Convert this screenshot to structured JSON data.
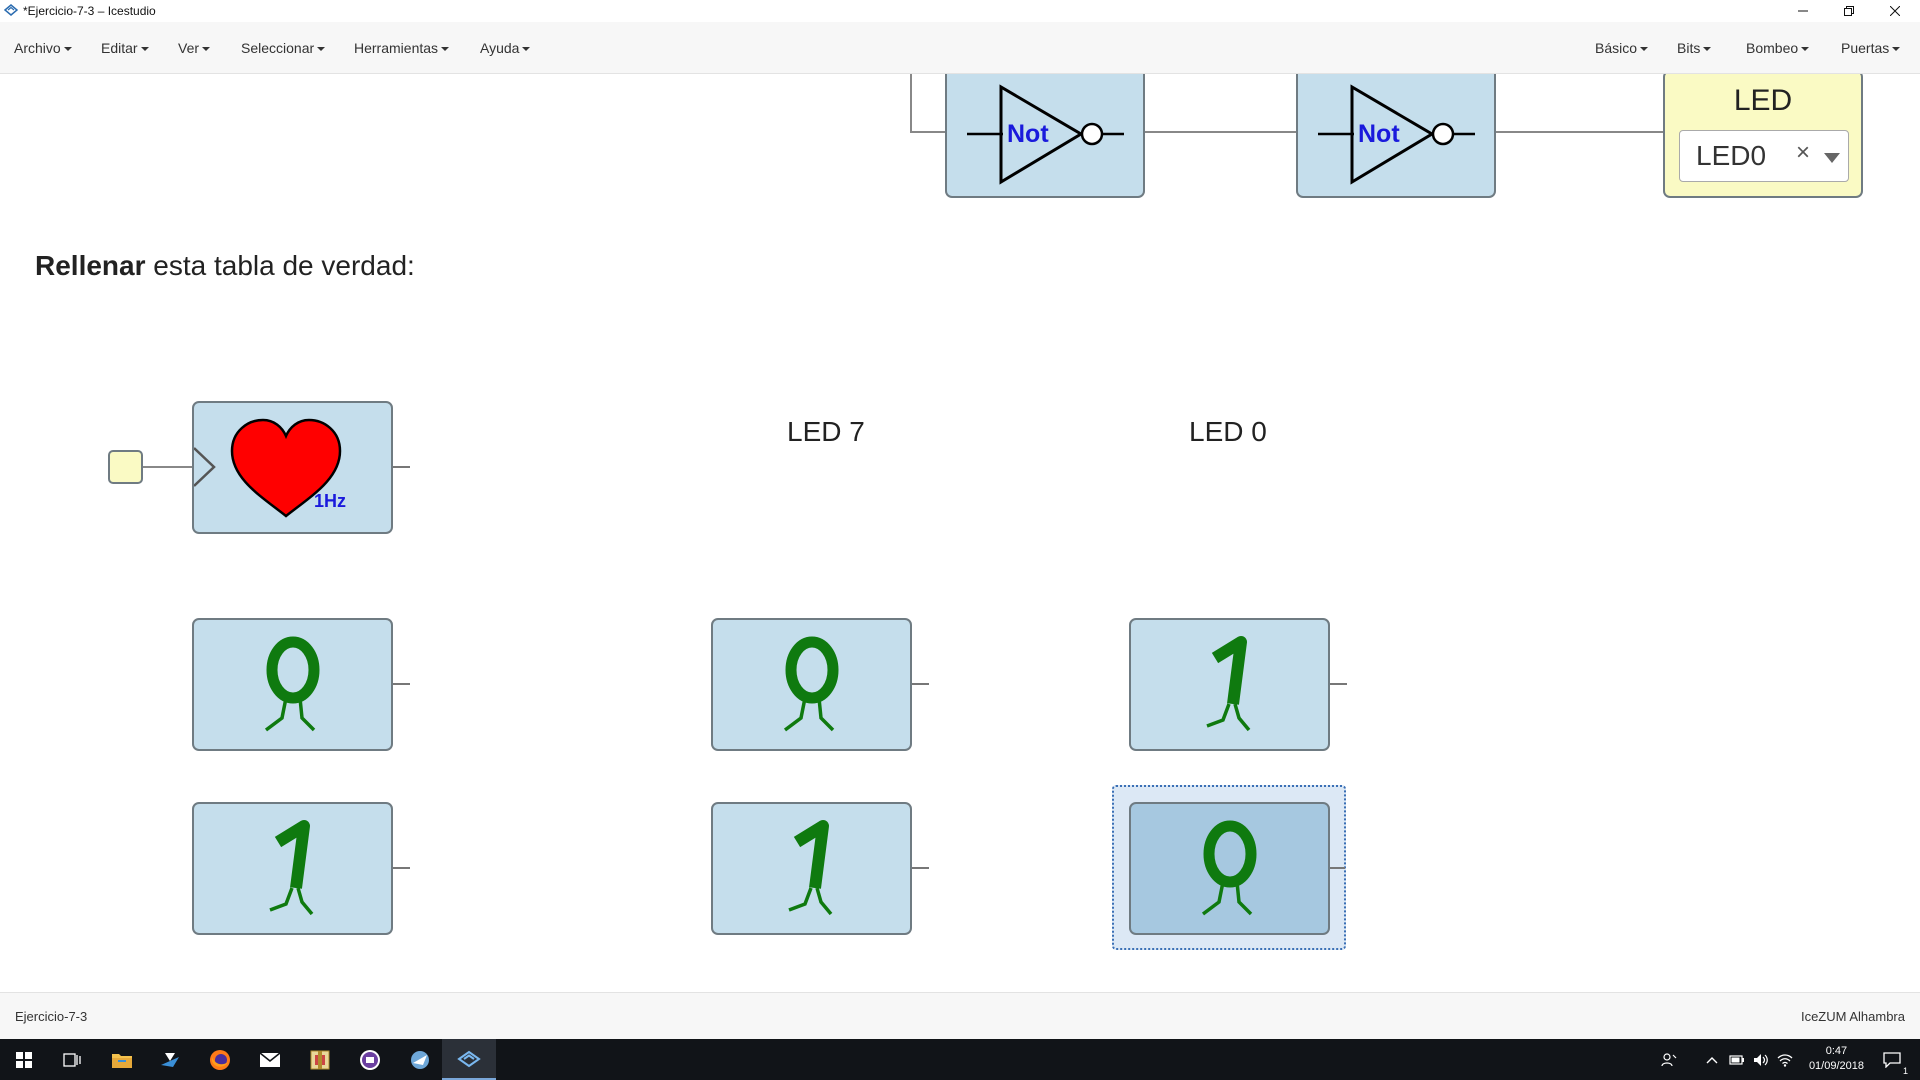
{
  "window": {
    "title": "*Ejercicio-7-3 – Icestudio",
    "minimize": "—",
    "restore": "❐",
    "close": "✕"
  },
  "menu_left": [
    "Archivo",
    "Editar",
    "Ver",
    "Seleccionar",
    "Herramientas",
    "Ayuda"
  ],
  "menu_right": [
    "Básico",
    "Bits",
    "Bombeo",
    "Puertas"
  ],
  "canvas": {
    "not_label": "Not",
    "led_block": {
      "title": "LED",
      "selected": "LED0",
      "clear": "×"
    },
    "instruction_bold": "Rellenar",
    "instruction_rest": " esta tabla de verdad:",
    "heartbeat_freq": "1Hz",
    "col_led7": "LED 7",
    "col_led0": "LED 0",
    "constants": {
      "r1c1": "0",
      "r1c2": "0",
      "r1c3": "1",
      "r2c1": "1",
      "r2c2": "1",
      "r2c3": "0"
    }
  },
  "status": {
    "left": "Ejercicio-7-3",
    "right": "IceZUM Alhambra"
  },
  "taskbar": {
    "time": "0:47",
    "date": "01/09/2018",
    "notifications": "1"
  },
  "colors": {
    "block_fill": "#c5deec",
    "led_fill": "#fafac4",
    "not_text": "#1a1adc",
    "digit": "#0f7a0f",
    "heart": "#ff0000",
    "selected_block": "#a6c8e0"
  }
}
